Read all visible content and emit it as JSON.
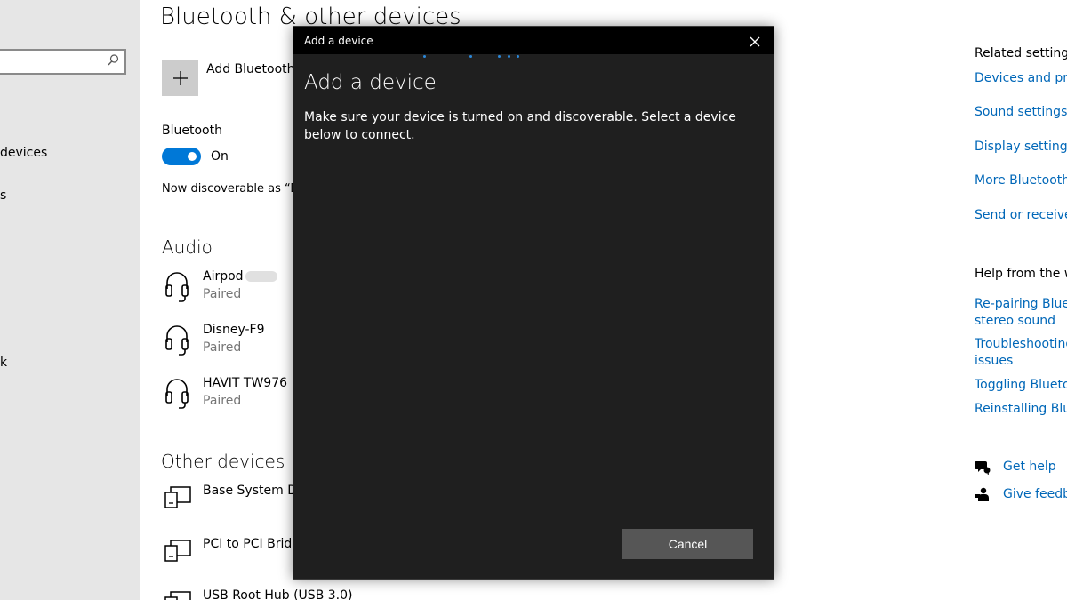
{
  "page": {
    "title": "Bluetooth & other devices",
    "add_device_label": "Add Bluetooth o",
    "bluetooth_label": "Bluetooth",
    "bluetooth_toggle_state": "On",
    "discoverable_text": "Now discoverable as “DE",
    "audio_heading": "Audio",
    "other_heading": "Other devices"
  },
  "left_nav": {
    "frag_devices": "devices",
    "frag_s": "s",
    "frag_k": "k"
  },
  "audio_devices": [
    {
      "name": "Airpod",
      "status": "Paired"
    },
    {
      "name": "Disney-F9",
      "status": "Paired"
    },
    {
      "name": "HAVIT TW976",
      "status": "Paired"
    }
  ],
  "other_devices": [
    {
      "name": "Base System Dev"
    },
    {
      "name": "PCI to PCI Bridge"
    },
    {
      "name": "USB Root Hub (USB 3.0)"
    }
  ],
  "related_settings": {
    "heading": "Related settings",
    "links": [
      "Devices and print",
      "Sound settings",
      "Display settings",
      "More Bluetooth o",
      "Send or receive fi"
    ]
  },
  "help": {
    "heading": "Help from the we",
    "links": [
      "Re-pairing Blueto",
      "stereo sound",
      "Troubleshooting",
      "issues",
      "Toggling Bluetoo",
      "Reinstalling Bluet"
    ],
    "get_help": "Get help",
    "give_feedback": "Give feedba"
  },
  "dialog": {
    "window_title": "Add a device",
    "heading": "Add a device",
    "instructions": "Make sure your device is turned on and discoverable. Select a device below to connect.",
    "cancel_label": "Cancel"
  },
  "colors": {
    "accent": "#0078d7",
    "link": "#0067b8",
    "dialog_bg": "#1f1f1f",
    "dialog_titlebar": "#000000",
    "cancel_button": "#565656"
  }
}
